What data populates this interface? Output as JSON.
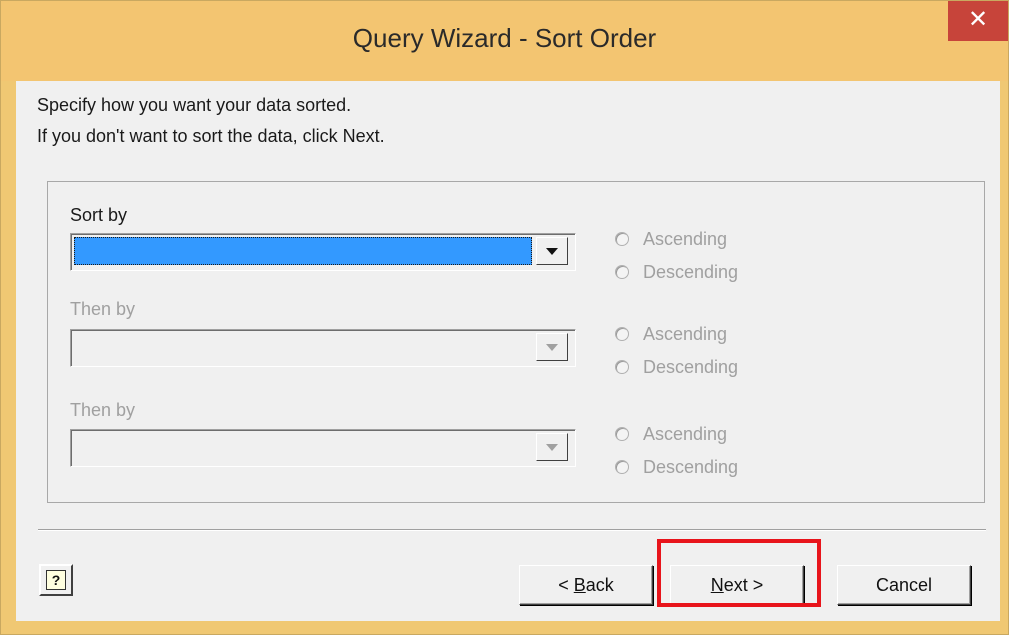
{
  "window": {
    "title": "Query Wizard - Sort Order",
    "close_glyph": "✕"
  },
  "instructions": {
    "line1": "Specify how you want your data sorted.",
    "line2": "If you don't want to sort the data, click Next."
  },
  "sort_levels": [
    {
      "label": "Sort by",
      "value": "",
      "enabled": true,
      "asc_label": "Ascending",
      "desc_label": "Descending"
    },
    {
      "label": "Then by",
      "value": "",
      "enabled": false,
      "asc_label": "Ascending",
      "desc_label": "Descending"
    },
    {
      "label": "Then by",
      "value": "",
      "enabled": false,
      "asc_label": "Ascending",
      "desc_label": "Descending"
    }
  ],
  "buttons": {
    "help_glyph": "?",
    "back_prefix": "< ",
    "back_mnemonic": "B",
    "back_rest": "ack",
    "next_mnemonic": "N",
    "next_rest": "ext >",
    "cancel": "Cancel"
  },
  "colors": {
    "title_bar": "#f3c571",
    "close_button": "#c7443a",
    "selection": "#3399ff",
    "highlight_box": "#e8141b",
    "disabled_text": "#a0a0a0"
  }
}
